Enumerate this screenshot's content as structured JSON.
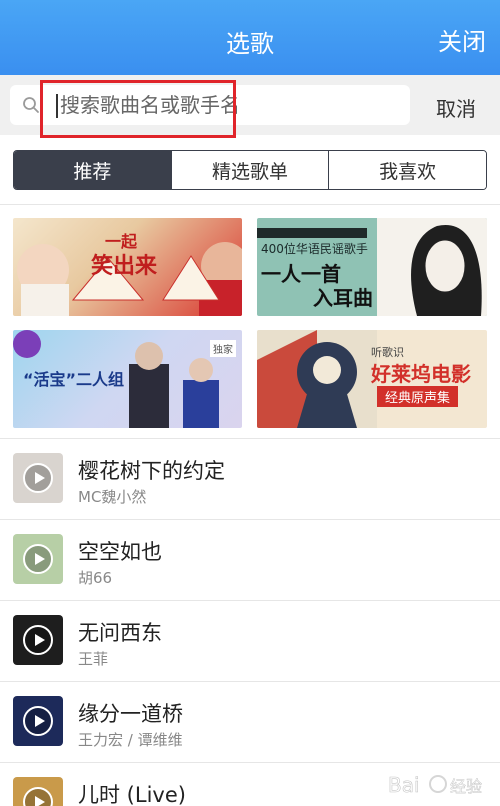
{
  "header": {
    "title": "选歌",
    "close_label": "关闭"
  },
  "search": {
    "placeholder": "搜索歌曲名或歌手名",
    "value": "",
    "cancel_label": "取消"
  },
  "tabs": [
    {
      "label": "推荐",
      "active": true
    },
    {
      "label": "精选歌单",
      "active": false
    },
    {
      "label": "我喜欢",
      "active": false
    }
  ],
  "banners": [
    {
      "line1": "一起",
      "line2": "笑出来"
    },
    {
      "line1": "400位华语民谣歌手",
      "line2": "一人一首",
      "line3": "入耳曲"
    },
    {
      "badge": "独家",
      "title": "“活宝”二人组"
    },
    {
      "line1": "听歌识",
      "line2": "好莱坞电影",
      "line3": "经典原声集"
    }
  ],
  "songs": [
    {
      "name": "樱花树下的约定",
      "artist": "MC魏小然"
    },
    {
      "name": "空空如也",
      "artist": "胡66"
    },
    {
      "name": "无问西东",
      "artist": "王菲"
    },
    {
      "name": "缘分一道桥",
      "artist": "王力宏 / 谭维维"
    },
    {
      "name": "儿时 (Live)",
      "artist": ""
    }
  ],
  "watermark": {
    "text": "Bai经验"
  },
  "colors": {
    "header_blue": "#3a8ff0",
    "tab_dark": "#3a3f4b",
    "highlight_red": "#e0242a"
  }
}
